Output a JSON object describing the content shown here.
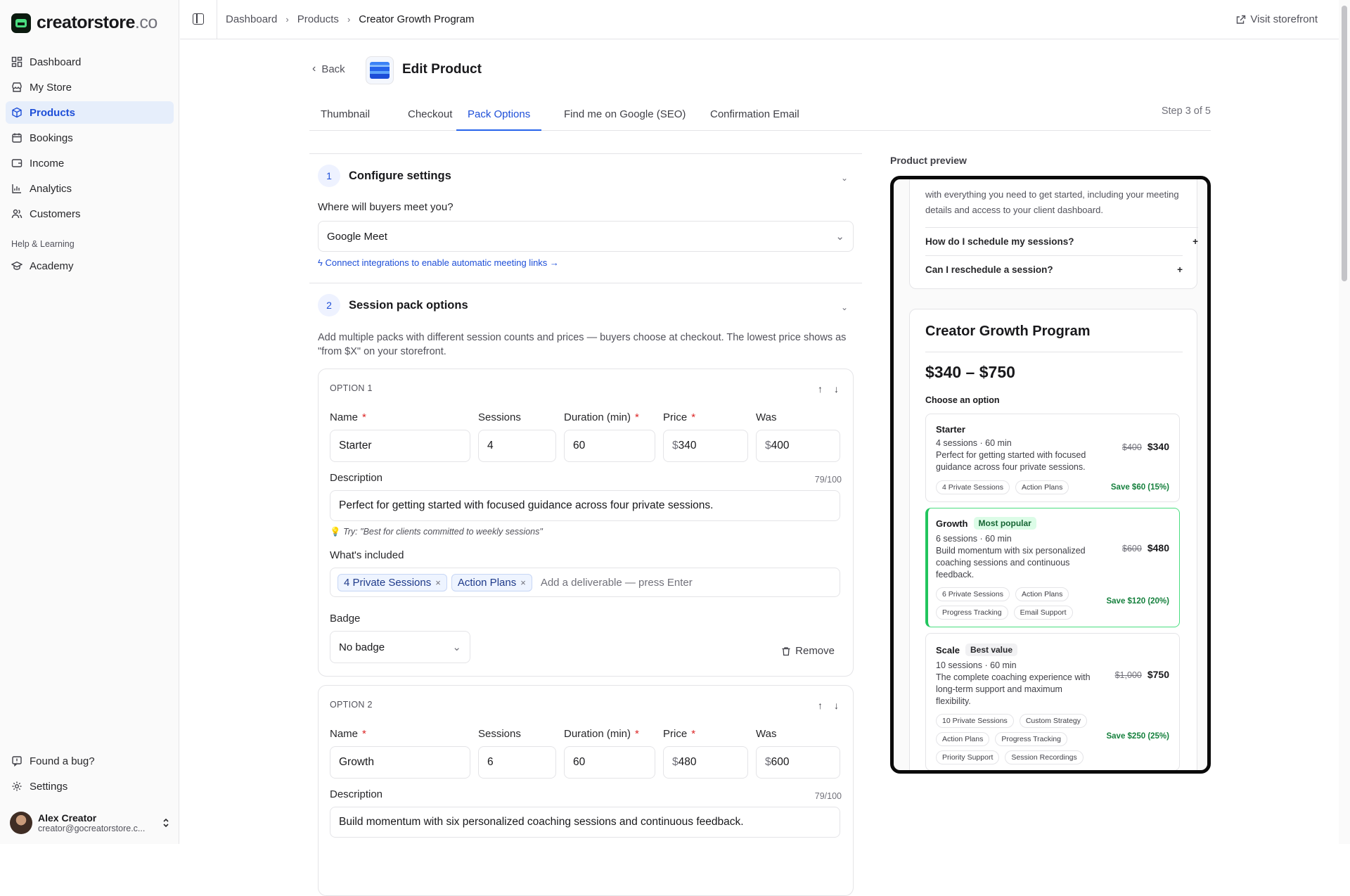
{
  "brand": {
    "name": "creatorstore",
    "suffix": ".co"
  },
  "sidebar": {
    "items": [
      {
        "label": "Dashboard",
        "icon": "dashboard-icon"
      },
      {
        "label": "My Store",
        "icon": "store-icon"
      },
      {
        "label": "Products",
        "icon": "box-icon",
        "active": true
      },
      {
        "label": "Bookings",
        "icon": "calendar-icon"
      },
      {
        "label": "Income",
        "icon": "wallet-icon"
      },
      {
        "label": "Analytics",
        "icon": "bar-chart-icon"
      },
      {
        "label": "Customers",
        "icon": "users-icon"
      }
    ],
    "group_label": "Help & Learning",
    "academy": "Academy",
    "bug": "Found a bug?",
    "settings": "Settings",
    "user": {
      "name": "Alex Creator",
      "email": "creator@gocreatorstore.c..."
    }
  },
  "topbar": {
    "crumbs": [
      "Dashboard",
      "Products",
      "Creator Growth Program"
    ],
    "visit": "Visit storefront"
  },
  "header": {
    "back": "Back",
    "title": "Edit Product"
  },
  "tabs": [
    "Thumbnail",
    "Checkout",
    "Pack Options",
    "Find me on Google (SEO)",
    "Confirmation Email"
  ],
  "step": "Step 3 of 5",
  "configure": {
    "num": "1",
    "title": "Configure settings",
    "question": "Where will buyers meet you?",
    "meeting": "Google Meet",
    "link": "Connect integrations to enable automatic meeting links →"
  },
  "packs": {
    "num": "2",
    "title": "Session pack options",
    "help": "Add multiple packs with different session counts and prices — buyers choose at checkout. The lowest price shows as \"from $X\" on your storefront.",
    "fields": {
      "name": "Name",
      "sessions": "Sessions",
      "duration": "Duration (min)",
      "price": "Price",
      "was": "Was",
      "description": "Description",
      "included": "What's included",
      "badge": "Badge",
      "currency": "$",
      "remove": "Remove",
      "placeholder": "Add a deliverable — press Enter"
    },
    "option1": {
      "label": "OPTION 1",
      "name": "Starter",
      "sessions": "4",
      "duration": "60",
      "price": "340",
      "was": "400",
      "counter": "79/100",
      "description": "Perfect for getting started with focused guidance across four private sessions.",
      "tip": "Try: \"Best for clients committed to weekly sessions\"",
      "tags": [
        "4 Private Sessions",
        "Action Plans"
      ],
      "badge": "No badge"
    },
    "option2": {
      "label": "OPTION 2",
      "name": "Growth",
      "sessions": "6",
      "duration": "60",
      "price": "480",
      "was": "600",
      "counter": "79/100",
      "description": "Build momentum with six personalized coaching sessions and continuous feedback."
    }
  },
  "preview": {
    "title": "Product preview",
    "intro": "with everything you need to get started, including your meeting details and access to your client dashboard.",
    "faq": [
      "How do I schedule my sessions?",
      "Can I reschedule a session?"
    ],
    "product": "Creator Growth Program",
    "range": "$340 – $750",
    "choose": "Choose an option",
    "options": [
      {
        "name": "Starter",
        "badge": "",
        "meta": "4 sessions · 60 min",
        "desc": "Perfect for getting started with focused guidance across four private sessions.",
        "was": "$400",
        "price": "$340",
        "chips": [
          "4 Private Sessions",
          "Action Plans"
        ],
        "save": "Save $60 (15%)"
      },
      {
        "name": "Growth",
        "badge": "Most popular",
        "meta": "6 sessions · 60 min",
        "desc": "Build momentum with six personalized coaching sessions and continuous feedback.",
        "was": "$600",
        "price": "$480",
        "chips": [
          "6 Private Sessions",
          "Action Plans",
          "Progress Tracking",
          "Email Support"
        ],
        "save": "Save $120 (20%)"
      },
      {
        "name": "Scale",
        "badge": "Best value",
        "meta": "10 sessions · 60 min",
        "desc": "The complete coaching experience with long-term support and maximum flexibility.",
        "was": "$1,000",
        "price": "$750",
        "chips": [
          "10 Private Sessions",
          "Custom Strategy",
          "Action Plans",
          "Progress Tracking",
          "Priority Support",
          "Session Recordings"
        ],
        "save": "Save $250 (25%)"
      }
    ]
  }
}
